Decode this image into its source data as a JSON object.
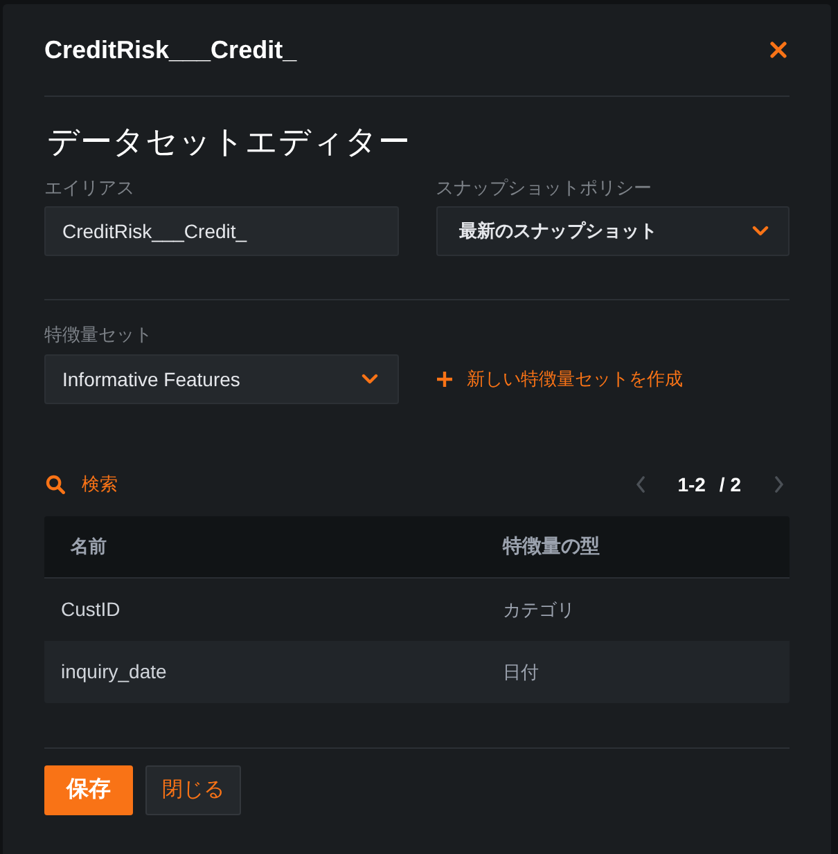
{
  "dialog": {
    "title": "CreditRisk___Credit_",
    "heading": "データセットエディター"
  },
  "fields": [
    {
      "kind": "input",
      "label": "エイリアス",
      "value": "CreditRisk___Credit_"
    },
    {
      "kind": "select",
      "label": "スナップショットポリシー",
      "value": "最新のスナップショット"
    }
  ],
  "feature_set": {
    "label": "特徴量セット",
    "value": "Informative Features",
    "create_link": "新しい特徴量セットを作成"
  },
  "search": {
    "label": "検索"
  },
  "pagination": {
    "range": "1-2",
    "total": "/ 2",
    "prev": {
      "disabled": true
    },
    "next": {
      "disabled": true
    }
  },
  "table": {
    "columns": [
      "名前",
      "特徴量の型"
    ],
    "rows": [
      [
        "CustID",
        "カテゴリ"
      ],
      [
        "inquiry_date",
        "日付"
      ]
    ]
  },
  "buttons": [
    {
      "kind": "primary",
      "label": "保存"
    },
    {
      "kind": "secondary",
      "label": "閉じる"
    }
  ]
}
